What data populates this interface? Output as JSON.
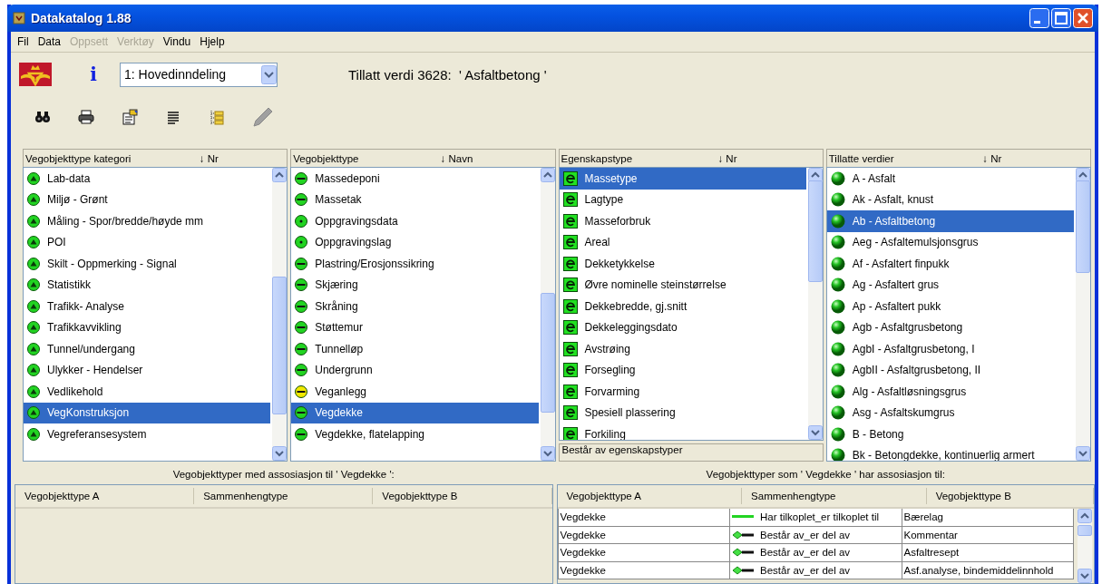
{
  "window": {
    "title": "Datakatalog 1.88"
  },
  "menu": [
    {
      "label": "Fil",
      "disabled": false
    },
    {
      "label": "Data",
      "disabled": false
    },
    {
      "label": "Oppsett",
      "disabled": true
    },
    {
      "label": "Verktøy",
      "disabled": true
    },
    {
      "label": "Vindu",
      "disabled": false
    },
    {
      "label": "Hjelp",
      "disabled": false
    }
  ],
  "toolbar": {
    "info": "i",
    "dropdown": "1: Hovedinndeling",
    "status_text": "Tillatt verdi 3628:  ' Asfaltbetong '"
  },
  "lists": [
    {
      "kind": "category",
      "title": "Vegobjekttype kategori",
      "sort": "↓ Nr",
      "items": [
        {
          "label": "Lab-data",
          "selected": false
        },
        {
          "label": "Miljø - Grønt",
          "selected": false
        },
        {
          "label": "Måling - Spor/bredde/høyde mm",
          "selected": false
        },
        {
          "label": "POI",
          "selected": false
        },
        {
          "label": "Skilt - Oppmerking - Signal",
          "selected": false
        },
        {
          "label": "Statistikk",
          "selected": false
        },
        {
          "label": "Trafikk-  Analyse",
          "selected": false
        },
        {
          "label": "Trafikkavvikling",
          "selected": false
        },
        {
          "label": "Tunnel/undergang",
          "selected": false
        },
        {
          "label": "Ulykker - Hendelser",
          "selected": false
        },
        {
          "label": "Vedlikehold",
          "selected": false
        },
        {
          "label": "VegKonstruksjon",
          "selected": true
        },
        {
          "label": "Vegreferansesystem",
          "selected": false
        }
      ]
    },
    {
      "kind": "objecttype",
      "title": "Vegobjekttype",
      "sort": "↓ Navn",
      "items": [
        {
          "label": "Massedeponi",
          "selected": false,
          "kind": "dash",
          "color": "#22d422"
        },
        {
          "label": "Massetak",
          "selected": false,
          "kind": "dash",
          "color": "#22d422"
        },
        {
          "label": "Oppgravingsdata",
          "selected": false,
          "kind": "dot",
          "color": "#22d422"
        },
        {
          "label": "Oppgravingslag",
          "selected": false,
          "kind": "dot",
          "color": "#22d422"
        },
        {
          "label": "Plastring/Erosjonssikring",
          "selected": false,
          "kind": "dash",
          "color": "#22d422"
        },
        {
          "label": "Skjæring",
          "selected": false,
          "kind": "dash",
          "color": "#22d422"
        },
        {
          "label": "Skråning",
          "selected": false,
          "kind": "dash",
          "color": "#22d422"
        },
        {
          "label": "Støttemur",
          "selected": false,
          "kind": "dash",
          "color": "#22d422"
        },
        {
          "label": "Tunnelløp",
          "selected": false,
          "kind": "dash",
          "color": "#22d422"
        },
        {
          "label": "Undergrunn",
          "selected": false,
          "kind": "dash",
          "color": "#22d422"
        },
        {
          "label": "Veganlegg",
          "selected": false,
          "kind": "dash",
          "color": "#f0e800"
        },
        {
          "label": "Vegdekke",
          "selected": true,
          "kind": "dash",
          "color": "#22d422"
        },
        {
          "label": "Vegdekke, flatelapping",
          "selected": false,
          "kind": "dash",
          "color": "#22d422"
        }
      ]
    },
    {
      "kind": "property",
      "title": "Egenskapstype",
      "sort": "↓ Nr",
      "footer": "Består av egenskapstyper",
      "items": [
        {
          "label": "Massetype",
          "selected": true
        },
        {
          "label": "Lagtype",
          "selected": false
        },
        {
          "label": "Masseforbruk",
          "selected": false
        },
        {
          "label": "Areal",
          "selected": false
        },
        {
          "label": "Dekketykkelse",
          "selected": false
        },
        {
          "label": "Øvre nominelle steinstørrelse",
          "selected": false
        },
        {
          "label": "Dekkebredde, gj.snitt",
          "selected": false
        },
        {
          "label": "Dekkeleggingsdato",
          "selected": false
        },
        {
          "label": "Avstrøing",
          "selected": false
        },
        {
          "label": "Forsegling",
          "selected": false
        },
        {
          "label": "Forvarming",
          "selected": false
        },
        {
          "label": "Spesiell plassering",
          "selected": false
        },
        {
          "label": "Forkiling",
          "selected": false
        }
      ]
    },
    {
      "kind": "value",
      "title": "Tillatte verdier",
      "sort": "↓ Nr",
      "items": [
        {
          "label": "A - Asfalt",
          "selected": false
        },
        {
          "label": "Ak - Asfalt, knust",
          "selected": false
        },
        {
          "label": "Ab - Asfaltbetong",
          "selected": true
        },
        {
          "label": "Aeg - Asfaltemulsjonsgrus",
          "selected": false
        },
        {
          "label": "Af - Asfaltert finpukk",
          "selected": false
        },
        {
          "label": "Ag - Asfaltert grus",
          "selected": false
        },
        {
          "label": "Ap - Asfaltert pukk",
          "selected": false
        },
        {
          "label": "Agb - Asfaltgrusbetong",
          "selected": false
        },
        {
          "label": "AgbI - Asfaltgrusbetong, I",
          "selected": false
        },
        {
          "label": "AgbII - Asfaltgrusbetong, II",
          "selected": false
        },
        {
          "label": "Alg - Asfaltløsningsgrus",
          "selected": false
        },
        {
          "label": "Asg - Asfaltskumgrus",
          "selected": false
        },
        {
          "label": "B - Betong",
          "selected": false
        },
        {
          "label": "Bk - Betongdekke, kontinuerlig armert",
          "selected": false
        }
      ]
    }
  ],
  "associations": [
    {
      "caption": "Vegobjekttyper med assosiasjon til ' Vegdekke ':",
      "columns": [
        "Vegobjekttype A",
        "Sammenhengtype",
        "Vegobjekttype B"
      ]
    },
    {
      "caption": "Vegobjekttyper som ' Vegdekke ' har assosiasjon til:",
      "columns": [
        "Vegobjekttype A",
        "Sammenhengtype",
        "Vegobjekttype B"
      ],
      "rows": [
        {
          "a": "Vegdekke",
          "kind": "line",
          "type": "Har tilkoplet_er tilkoplet til",
          "b": "Bærelag"
        },
        {
          "a": "Vegdekke",
          "kind": "diamond",
          "type": "Består av_er del av",
          "b": "Kommentar"
        },
        {
          "a": "Vegdekke",
          "kind": "diamond",
          "type": "Består av_er del av",
          "b": "Asfaltresept"
        },
        {
          "a": "Vegdekke",
          "kind": "diamond",
          "type": "Består av_er del av",
          "b": "Asf.analyse, bindemiddelinnhold"
        }
      ]
    }
  ]
}
